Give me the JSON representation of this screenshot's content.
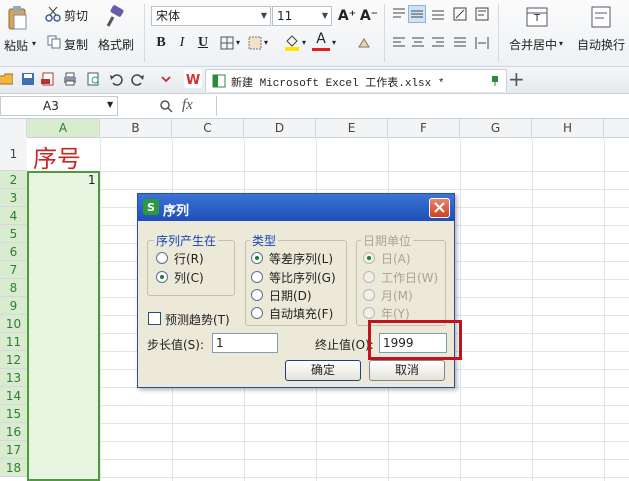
{
  "ribbon": {
    "paste_label": "粘贴",
    "cut_label": "剪切",
    "copy_label": "复制",
    "format_painter_label": "格式刷",
    "font_name": "宋体",
    "font_size": "11",
    "bold": "B",
    "italic": "I",
    "underline": "U",
    "grow_font": "A⁺",
    "shrink_font": "A⁻",
    "font_color_glyph": "A",
    "merge_center_label": "合并居中",
    "wrap_text_label": "自动换行"
  },
  "tabbar": {
    "doc_title": "新建 Microsoft Excel 工作表.xlsx *",
    "add_tab": "+"
  },
  "formula_bar": {
    "cell_ref": "A3",
    "fx": "fx"
  },
  "sheet": {
    "columns": [
      "A",
      "B",
      "C",
      "D",
      "E",
      "F",
      "G",
      "H"
    ],
    "rows": [
      "1",
      "2",
      "3",
      "4",
      "5",
      "6",
      "7",
      "8",
      "9",
      "10",
      "11",
      "12",
      "13",
      "14",
      "15",
      "16",
      "17",
      "18"
    ],
    "a1": "序号",
    "a2": "1"
  },
  "dialog": {
    "title": "序列",
    "group_series_in": "序列产生在",
    "opt_rows": "行(R)",
    "opt_cols": "列(C)",
    "group_type": "类型",
    "opt_linear": "等差序列(L)",
    "opt_growth": "等比序列(G)",
    "opt_date": "日期(D)",
    "opt_autofill": "自动填充(F)",
    "group_date_unit": "日期单位",
    "opt_day": "日(A)",
    "opt_weekday": "工作日(W)",
    "opt_month": "月(M)",
    "opt_year": "年(Y)",
    "trend_label": "预测趋势(T)",
    "step_label": "步长值(S):",
    "step_value": "1",
    "stop_label": "终止值(O):",
    "stop_value": "1999",
    "ok_label": "确定",
    "cancel_label": "取消"
  },
  "colors": {
    "title_bar": "#1f4fb8",
    "highlight": "#c0141c",
    "selection": "#e7f4e0",
    "a1_text": "#c62828"
  }
}
